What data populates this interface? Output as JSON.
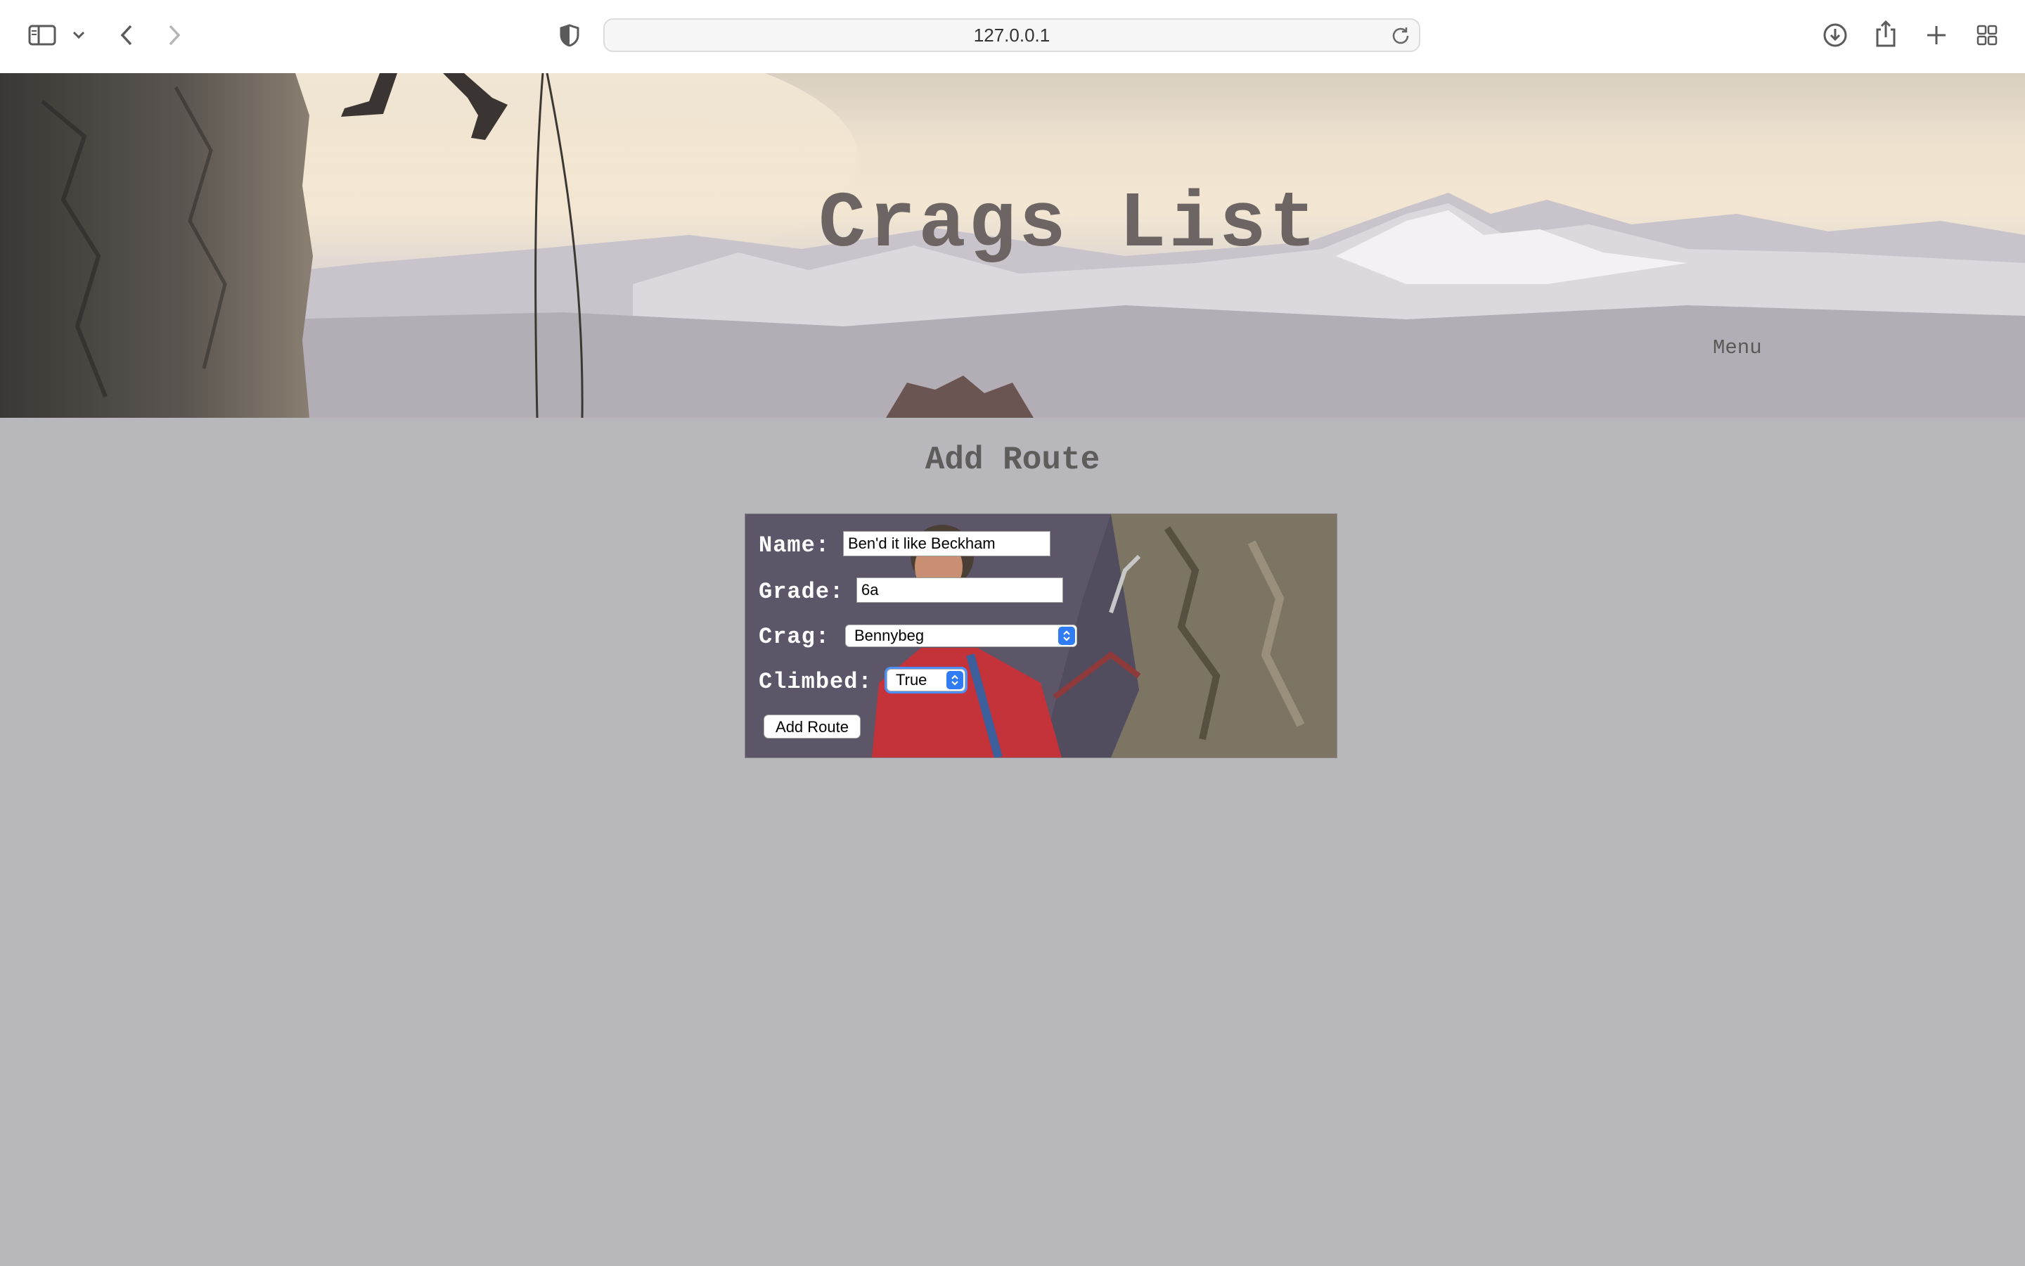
{
  "browser": {
    "url": "127.0.0.1",
    "icons": [
      "sidebar-icon",
      "chevron-down-icon",
      "back-icon",
      "forward-icon",
      "shield-icon",
      "reload-icon",
      "download-icon",
      "share-icon",
      "new-tab-icon",
      "tab-overview-icon"
    ]
  },
  "header": {
    "title": "Crags List",
    "menu_label": "Menu"
  },
  "main": {
    "heading": "Add Route"
  },
  "form": {
    "name_label": "Name:",
    "name_value": "Ben'd it like Beckham",
    "grade_label": "Grade:",
    "grade_value": "6a",
    "crag_label": "Crag:",
    "crag_value": "Bennybeg",
    "climbed_label": "Climbed:",
    "climbed_value": "True",
    "submit_label": "Add Route"
  },
  "colors": {
    "page_background": "#b7b7bc",
    "title_color": "#6c6563",
    "select_accent": "#2f7cf5"
  }
}
